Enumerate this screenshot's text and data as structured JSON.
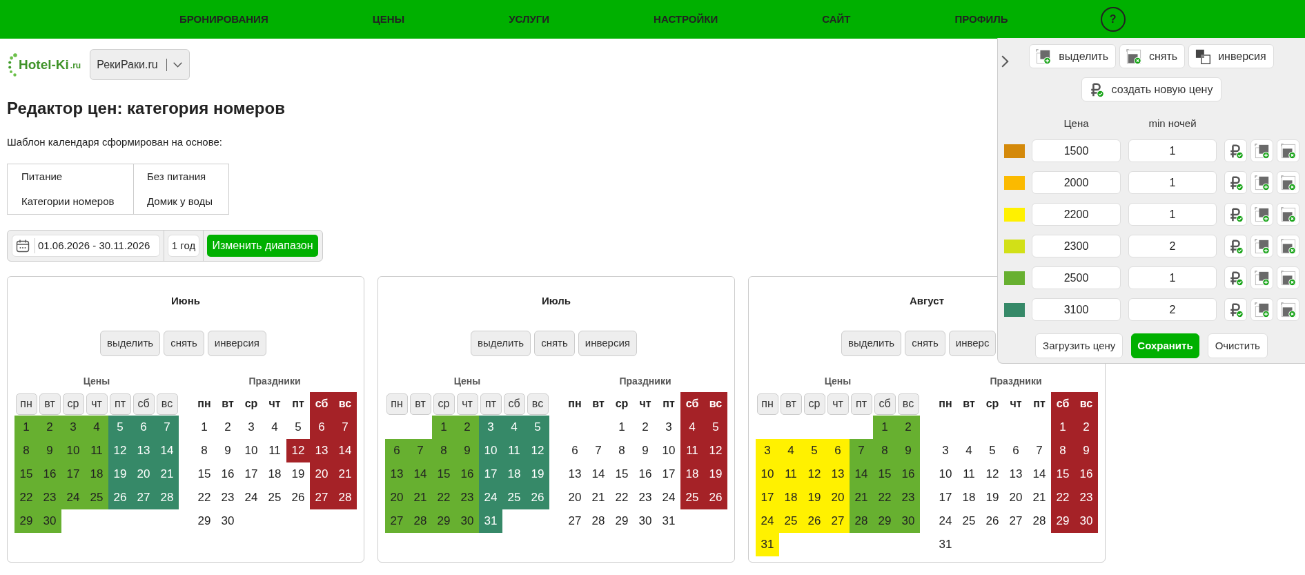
{
  "nav": {
    "items": [
      "БРОНИРОВАНИЯ",
      "ЦЕНЫ",
      "УСЛУГИ",
      "НАСТРОЙКИ",
      "САЙТ",
      "ПРОФИЛЬ"
    ],
    "help": "?"
  },
  "header": {
    "logo": {
      "text": "Hotel-Ki",
      "suffix": ".ru"
    },
    "hotel_select": {
      "value": "РекиРаки.ru"
    }
  },
  "title": "Редактор цен: категория номеров",
  "template": {
    "caption": "Шаблон календаря сформирован на основе:",
    "rows": [
      [
        "Питание",
        "Без питания"
      ],
      [
        "Категории номеров",
        "Домик у воды"
      ]
    ]
  },
  "range": {
    "dates": "01.06.2026 - 30.11.2026",
    "period": "1 год",
    "button": "Изменить диапазон"
  },
  "months": [
    {
      "title": "Июнь",
      "buttons": [
        "выделить",
        "снять",
        "инверсия"
      ],
      "prices": {
        "label": "Цены",
        "weekdays": [
          "пн",
          "вт",
          "ср",
          "чт",
          "пт",
          "сб",
          "вс"
        ],
        "weeks": [
          [
            {
              "day": "1",
              "color": "#67b030"
            },
            {
              "day": "2",
              "color": "#67b030"
            },
            {
              "day": "3",
              "color": "#67b030"
            },
            {
              "day": "4",
              "color": "#67b030"
            },
            {
              "day": "5",
              "color": "#368968"
            },
            {
              "day": "6",
              "color": "#368968"
            },
            {
              "day": "7",
              "color": "#368968"
            }
          ],
          [
            {
              "day": "8",
              "color": "#67b030"
            },
            {
              "day": "9",
              "color": "#67b030"
            },
            {
              "day": "10",
              "color": "#67b030"
            },
            {
              "day": "11",
              "color": "#67b030"
            },
            {
              "day": "12",
              "color": "#368968"
            },
            {
              "day": "13",
              "color": "#368968"
            },
            {
              "day": "14",
              "color": "#368968"
            }
          ],
          [
            {
              "day": "15",
              "color": "#67b030"
            },
            {
              "day": "16",
              "color": "#67b030"
            },
            {
              "day": "17",
              "color": "#67b030"
            },
            {
              "day": "18",
              "color": "#67b030"
            },
            {
              "day": "19",
              "color": "#368968"
            },
            {
              "day": "20",
              "color": "#368968"
            },
            {
              "day": "21",
              "color": "#368968"
            }
          ],
          [
            {
              "day": "22",
              "color": "#67b030"
            },
            {
              "day": "23",
              "color": "#67b030"
            },
            {
              "day": "24",
              "color": "#67b030"
            },
            {
              "day": "25",
              "color": "#67b030"
            },
            {
              "day": "26",
              "color": "#368968"
            },
            {
              "day": "27",
              "color": "#368968"
            },
            {
              "day": "28",
              "color": "#368968"
            }
          ],
          [
            {
              "day": "29",
              "color": "#67b030"
            },
            {
              "day": "30",
              "color": "#67b030"
            }
          ]
        ]
      },
      "holidays": {
        "label": "Праздники",
        "weekdays": [
          {
            "label": "пн",
            "holiday": false
          },
          {
            "label": "вт",
            "holiday": false
          },
          {
            "label": "ср",
            "holiday": false
          },
          {
            "label": "чт",
            "holiday": false
          },
          {
            "label": "пт",
            "holiday": false
          },
          {
            "label": "сб",
            "holiday": true
          },
          {
            "label": "вс",
            "holiday": true
          }
        ],
        "weeks": [
          [
            {
              "day": "1",
              "holiday": false
            },
            {
              "day": "2",
              "holiday": false
            },
            {
              "day": "3",
              "holiday": false
            },
            {
              "day": "4",
              "holiday": false
            },
            {
              "day": "5",
              "holiday": false
            },
            {
              "day": "6",
              "holiday": true
            },
            {
              "day": "7",
              "holiday": true
            }
          ],
          [
            {
              "day": "8",
              "holiday": false
            },
            {
              "day": "9",
              "holiday": false
            },
            {
              "day": "10",
              "holiday": false
            },
            {
              "day": "11",
              "holiday": false
            },
            {
              "day": "12",
              "holiday": true
            },
            {
              "day": "13",
              "holiday": true
            },
            {
              "day": "14",
              "holiday": true
            }
          ],
          [
            {
              "day": "15",
              "holiday": false
            },
            {
              "day": "16",
              "holiday": false
            },
            {
              "day": "17",
              "holiday": false
            },
            {
              "day": "18",
              "holiday": false
            },
            {
              "day": "19",
              "holiday": false
            },
            {
              "day": "20",
              "holiday": true
            },
            {
              "day": "21",
              "holiday": true
            }
          ],
          [
            {
              "day": "22",
              "holiday": false
            },
            {
              "day": "23",
              "holiday": false
            },
            {
              "day": "24",
              "holiday": false
            },
            {
              "day": "25",
              "holiday": false
            },
            {
              "day": "26",
              "holiday": false
            },
            {
              "day": "27",
              "holiday": true
            },
            {
              "day": "28",
              "holiday": true
            }
          ],
          [
            {
              "day": "29",
              "holiday": false
            },
            {
              "day": "30",
              "holiday": false
            }
          ]
        ]
      }
    },
    {
      "title": "Июль",
      "buttons": [
        "выделить",
        "снять",
        "инверсия"
      ],
      "prices": {
        "label": "Цены",
        "weekdays": [
          "пн",
          "вт",
          "ср",
          "чт",
          "пт",
          "сб",
          "вс"
        ],
        "weeks": [
          [
            {
              "day": "1",
              "color": "#67b030"
            },
            {
              "day": "2",
              "color": "#67b030"
            },
            {
              "day": "3",
              "color": "#368968"
            },
            {
              "day": "4",
              "color": "#368968"
            },
            {
              "day": "5",
              "color": "#368968"
            }
          ],
          [
            {
              "day": "6",
              "color": "#67b030"
            },
            {
              "day": "7",
              "color": "#67b030"
            },
            {
              "day": "8",
              "color": "#67b030"
            },
            {
              "day": "9",
              "color": "#67b030"
            },
            {
              "day": "10",
              "color": "#368968"
            },
            {
              "day": "11",
              "color": "#368968"
            },
            {
              "day": "12",
              "color": "#368968"
            }
          ],
          [
            {
              "day": "13",
              "color": "#67b030"
            },
            {
              "day": "14",
              "color": "#67b030"
            },
            {
              "day": "15",
              "color": "#67b030"
            },
            {
              "day": "16",
              "color": "#67b030"
            },
            {
              "day": "17",
              "color": "#368968"
            },
            {
              "day": "18",
              "color": "#368968"
            },
            {
              "day": "19",
              "color": "#368968"
            }
          ],
          [
            {
              "day": "20",
              "color": "#67b030"
            },
            {
              "day": "21",
              "color": "#67b030"
            },
            {
              "day": "22",
              "color": "#67b030"
            },
            {
              "day": "23",
              "color": "#67b030"
            },
            {
              "day": "24",
              "color": "#368968"
            },
            {
              "day": "25",
              "color": "#368968"
            },
            {
              "day": "26",
              "color": "#368968"
            }
          ],
          [
            {
              "day": "27",
              "color": "#67b030"
            },
            {
              "day": "28",
              "color": "#67b030"
            },
            {
              "day": "29",
              "color": "#67b030"
            },
            {
              "day": "30",
              "color": "#67b030"
            },
            {
              "day": "31",
              "color": "#368968"
            }
          ]
        ]
      },
      "holidays": {
        "label": "Праздники",
        "weekdays": [
          {
            "label": "пн",
            "holiday": false
          },
          {
            "label": "вт",
            "holiday": false
          },
          {
            "label": "ср",
            "holiday": false
          },
          {
            "label": "чт",
            "holiday": false
          },
          {
            "label": "пт",
            "holiday": false
          },
          {
            "label": "сб",
            "holiday": true
          },
          {
            "label": "вс",
            "holiday": true
          }
        ],
        "weeks": [
          [
            {
              "day": "1",
              "holiday": false
            },
            {
              "day": "2",
              "holiday": false
            },
            {
              "day": "3",
              "holiday": false
            },
            {
              "day": "4",
              "holiday": true
            },
            {
              "day": "5",
              "holiday": true
            }
          ],
          [
            {
              "day": "6",
              "holiday": false
            },
            {
              "day": "7",
              "holiday": false
            },
            {
              "day": "8",
              "holiday": false
            },
            {
              "day": "9",
              "holiday": false
            },
            {
              "day": "10",
              "holiday": false
            },
            {
              "day": "11",
              "holiday": true
            },
            {
              "day": "12",
              "holiday": true
            }
          ],
          [
            {
              "day": "13",
              "holiday": false
            },
            {
              "day": "14",
              "holiday": false
            },
            {
              "day": "15",
              "holiday": false
            },
            {
              "day": "16",
              "holiday": false
            },
            {
              "day": "17",
              "holiday": false
            },
            {
              "day": "18",
              "holiday": true
            },
            {
              "day": "19",
              "holiday": true
            }
          ],
          [
            {
              "day": "20",
              "holiday": false
            },
            {
              "day": "21",
              "holiday": false
            },
            {
              "day": "22",
              "holiday": false
            },
            {
              "day": "23",
              "holiday": false
            },
            {
              "day": "24",
              "holiday": false
            },
            {
              "day": "25",
              "holiday": true
            },
            {
              "day": "26",
              "holiday": true
            }
          ],
          [
            {
              "day": "27",
              "holiday": false
            },
            {
              "day": "28",
              "holiday": false
            },
            {
              "day": "29",
              "holiday": false
            },
            {
              "day": "30",
              "holiday": false
            },
            {
              "day": "31",
              "holiday": false
            }
          ]
        ]
      }
    },
    {
      "title": "Август",
      "buttons": [
        "выделить",
        "снять",
        "инверс"
      ],
      "prices": {
        "label": "Цены",
        "weekdays": [
          "пн",
          "вт",
          "ср",
          "чт",
          "пт",
          "сб",
          "вс"
        ],
        "weeks": [
          [
            {
              "day": "1",
              "color": "#67b030"
            },
            {
              "day": "2",
              "color": "#67b030"
            }
          ],
          [
            {
              "day": "3",
              "color": "#fff100"
            },
            {
              "day": "4",
              "color": "#fff100"
            },
            {
              "day": "5",
              "color": "#fff100"
            },
            {
              "day": "6",
              "color": "#fff100"
            },
            {
              "day": "7",
              "color": "#67b030"
            },
            {
              "day": "8",
              "color": "#67b030"
            },
            {
              "day": "9",
              "color": "#67b030"
            }
          ],
          [
            {
              "day": "10",
              "color": "#fff100"
            },
            {
              "day": "11",
              "color": "#fff100"
            },
            {
              "day": "12",
              "color": "#fff100"
            },
            {
              "day": "13",
              "color": "#fff100"
            },
            {
              "day": "14",
              "color": "#67b030"
            },
            {
              "day": "15",
              "color": "#67b030"
            },
            {
              "day": "16",
              "color": "#67b030"
            }
          ],
          [
            {
              "day": "17",
              "color": "#fff100"
            },
            {
              "day": "18",
              "color": "#fff100"
            },
            {
              "day": "19",
              "color": "#fff100"
            },
            {
              "day": "20",
              "color": "#fff100"
            },
            {
              "day": "21",
              "color": "#67b030"
            },
            {
              "day": "22",
              "color": "#67b030"
            },
            {
              "day": "23",
              "color": "#67b030"
            }
          ],
          [
            {
              "day": "24",
              "color": "#fff100"
            },
            {
              "day": "25",
              "color": "#fff100"
            },
            {
              "day": "26",
              "color": "#fff100"
            },
            {
              "day": "27",
              "color": "#fff100"
            },
            {
              "day": "28",
              "color": "#67b030"
            },
            {
              "day": "29",
              "color": "#67b030"
            },
            {
              "day": "30",
              "color": "#67b030"
            }
          ],
          [
            {
              "day": "31",
              "color": "#fff100"
            }
          ]
        ]
      },
      "holidays": {
        "label": "Праздники",
        "weekdays": [
          {
            "label": "пн",
            "holiday": false
          },
          {
            "label": "вт",
            "holiday": false
          },
          {
            "label": "ср",
            "holiday": false
          },
          {
            "label": "чт",
            "holiday": false
          },
          {
            "label": "пт",
            "holiday": false
          },
          {
            "label": "сб",
            "holiday": true
          },
          {
            "label": "вс",
            "holiday": true
          }
        ],
        "weeks": [
          [
            {
              "day": "1",
              "holiday": true
            },
            {
              "day": "2",
              "holiday": true
            }
          ],
          [
            {
              "day": "3",
              "holiday": false
            },
            {
              "day": "4",
              "holiday": false
            },
            {
              "day": "5",
              "holiday": false
            },
            {
              "day": "6",
              "holiday": false
            },
            {
              "day": "7",
              "holiday": false
            },
            {
              "day": "8",
              "holiday": true
            },
            {
              "day": "9",
              "holiday": true
            }
          ],
          [
            {
              "day": "10",
              "holiday": false
            },
            {
              "day": "11",
              "holiday": false
            },
            {
              "day": "12",
              "holiday": false
            },
            {
              "day": "13",
              "holiday": false
            },
            {
              "day": "14",
              "holiday": false
            },
            {
              "day": "15",
              "holiday": true
            },
            {
              "day": "16",
              "holiday": true
            }
          ],
          [
            {
              "day": "17",
              "holiday": false
            },
            {
              "day": "18",
              "holiday": false
            },
            {
              "day": "19",
              "holiday": false
            },
            {
              "day": "20",
              "holiday": false
            },
            {
              "day": "21",
              "holiday": false
            },
            {
              "day": "22",
              "holiday": true
            },
            {
              "day": "23",
              "holiday": true
            }
          ],
          [
            {
              "day": "24",
              "holiday": false
            },
            {
              "day": "25",
              "holiday": false
            },
            {
              "day": "26",
              "holiday": false
            },
            {
              "day": "27",
              "holiday": false
            },
            {
              "day": "28",
              "holiday": false
            },
            {
              "day": "29",
              "holiday": true
            },
            {
              "day": "30",
              "holiday": true
            }
          ],
          [
            {
              "day": "31",
              "holiday": false
            }
          ]
        ]
      }
    }
  ],
  "price_panel": {
    "actions": [
      {
        "kind": "select",
        "label": "выделить"
      },
      {
        "kind": "deselect",
        "label": "снять"
      },
      {
        "kind": "invert",
        "label": "инверсия"
      }
    ],
    "create_button": "создать новую цену",
    "columns": [
      "Цена",
      "min ночей"
    ],
    "prices": [
      {
        "color": "#d4890a",
        "price": "1500",
        "min_nights": "1"
      },
      {
        "color": "#fbba00",
        "price": "2000",
        "min_nights": "1"
      },
      {
        "color": "#fff100",
        "price": "2200",
        "min_nights": "1"
      },
      {
        "color": "#d2e017",
        "price": "2300",
        "min_nights": "2"
      },
      {
        "color": "#67b030",
        "price": "2500",
        "min_nights": "1"
      },
      {
        "color": "#368968",
        "price": "3100",
        "min_nights": "2"
      }
    ],
    "buttons": [
      {
        "label": "Загрузить цену",
        "primary": false
      },
      {
        "label": "Сохранить",
        "primary": true
      },
      {
        "label": "Очистить",
        "primary": false
      }
    ]
  }
}
